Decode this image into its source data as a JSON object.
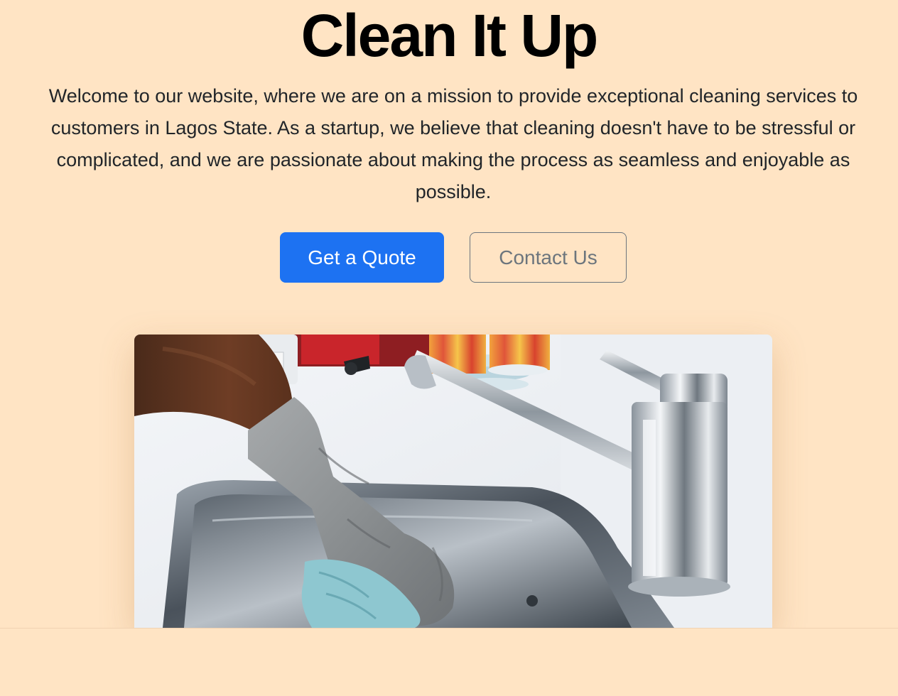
{
  "hero": {
    "title": "Clean It Up",
    "lead": "Welcome to our website, where we are on a mission to provide exceptional cleaning services to customers in Lagos State. As a startup, we believe that cleaning doesn't have to be stressful or complicated, and we are passionate about making the process as seamless and enjoyable as possible.",
    "primary_button": "Get a Quote",
    "secondary_button": "Contact Us"
  },
  "colors": {
    "background": "#ffe4c4",
    "primary": "#1d72f2",
    "outline": "#6c757d",
    "text": "#212529"
  },
  "image": {
    "subject": "gloved-hand-cleaning-sink-photo"
  }
}
